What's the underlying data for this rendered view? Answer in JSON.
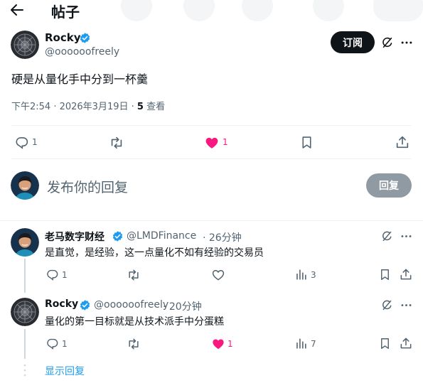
{
  "header": {
    "title": "帖子"
  },
  "post": {
    "author_name": "Rocky",
    "author_handle": "@oooooofreely",
    "subscribe_label": "订阅",
    "text": "硬是从量化手中分到一杯羹",
    "time": "下午2:54 · 2026年3月19日 · ",
    "views_count": "5",
    "views_label": " 查看",
    "replies_count": "1",
    "likes_count": "1"
  },
  "composer": {
    "placeholder": "发布你的回复",
    "reply_label": "回复"
  },
  "replies": [
    {
      "name": "老马数字财经",
      "handle": "@LMDFinance",
      "time": "· 26分钟",
      "text": "是直觉，是经验，这一点量化不如有经验的交易员",
      "replies_count": "1",
      "views_count": "3"
    },
    {
      "name": "Rocky",
      "handle": "@oooooofreely",
      "time": "· 20分钟",
      "text": "量化的第一目标就是从技术派手中分蛋糕",
      "replies_count": "1",
      "likes_count": "1",
      "views_count": "7"
    }
  ],
  "show_replies_label": "显示回复",
  "colors": {
    "accent": "#1d9bf0",
    "like": "#f91880",
    "verified": "#1d9bf0"
  }
}
